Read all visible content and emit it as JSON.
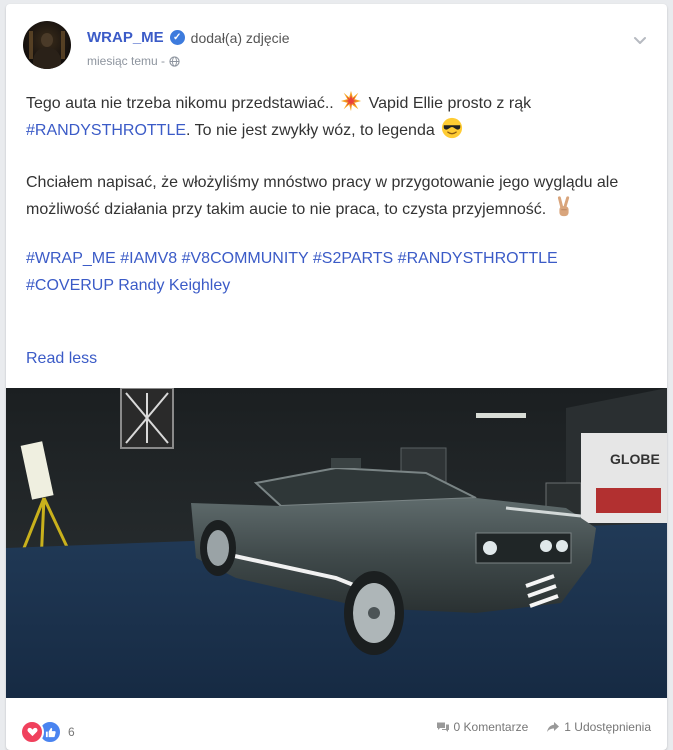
{
  "post": {
    "author": "WRAP_ME",
    "action": "dodał(a) zdjęcie",
    "time": "miesiąc temu -",
    "para1": {
      "t1": "Tego auta nie trzeba nikomu przedstawiać..",
      "t2": "Vapid Ellie prosto z rąk",
      "tag": "#RANDYSTHROTTLE",
      "t3": ". To nie jest zwykły wóz, to legenda"
    },
    "para2": "Chciałem napisać, że włożyliśmy mnóstwo pracy w przygotowanie jego wyglądu ale możliwość działania przy takim aucie to nie praca, to czysta przyjemność.",
    "hashtags": "#WRAP_ME #IAMV8 #V8COMMUNITY #S2PARTS #RANDYSTHROTTLE #COVERUP",
    "mention": "Randy Keighley",
    "read_less": "Read less",
    "photo_sign": "GLOBE"
  },
  "footer": {
    "reaction_count": "6",
    "comments": "0 Komentarze",
    "shares": "1 Udostępnienia"
  },
  "icons": [
    "verified-icon",
    "globe-icon",
    "chevron-down-icon",
    "collision-emoji",
    "sunglasses-emoji",
    "victory-hand-emoji",
    "heart-icon",
    "like-icon",
    "comment-icon",
    "share-icon"
  ],
  "colors": {
    "link": "#3b5bc7",
    "background": "#e9ebee",
    "heart": "#f0415d",
    "like": "#4a84f0"
  }
}
